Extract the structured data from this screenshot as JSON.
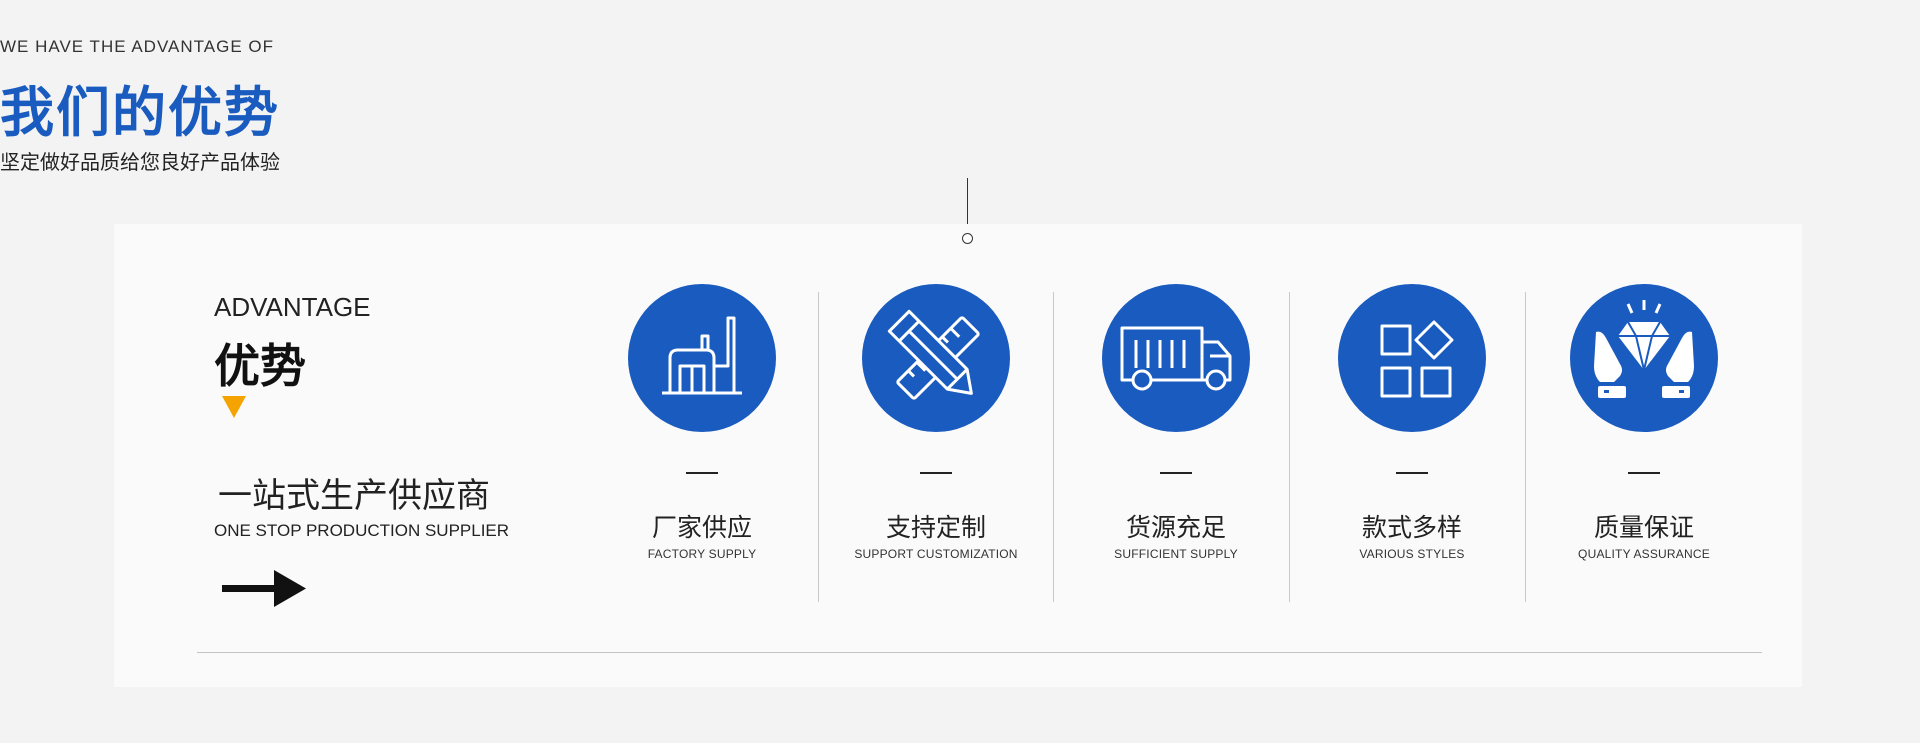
{
  "header": {
    "eyebrow": "WE HAVE THE ADVANTAGE OF",
    "title": "我们的优势",
    "subtitle": "坚定做好品质给您良好产品体验"
  },
  "intro": {
    "label_en": "ADVANTAGE",
    "label_cn": "优势",
    "slogan_cn": "一站式生产供应商",
    "slogan_en": "ONE STOP PRODUCTION SUPPLIER"
  },
  "features": [
    {
      "cn": "厂家供应",
      "en": "FACTORY SUPPLY",
      "icon": "factory-icon"
    },
    {
      "cn": "支持定制",
      "en": "SUPPORT CUSTOMIZATION",
      "icon": "pencil-ruler-icon"
    },
    {
      "cn": "货源充足",
      "en": "SUFFICIENT SUPPLY",
      "icon": "truck-icon"
    },
    {
      "cn": "款式多样",
      "en": "VARIOUS STYLES",
      "icon": "shapes-grid-icon"
    },
    {
      "cn": "质量保证",
      "en": "QUALITY ASSURANCE",
      "icon": "diamond-hands-icon"
    }
  ],
  "colors": {
    "accent_blue": "#1a5bbf",
    "triangle_orange": "#f5a300",
    "background": "#f3f3f3",
    "panel": "#fafafa"
  }
}
